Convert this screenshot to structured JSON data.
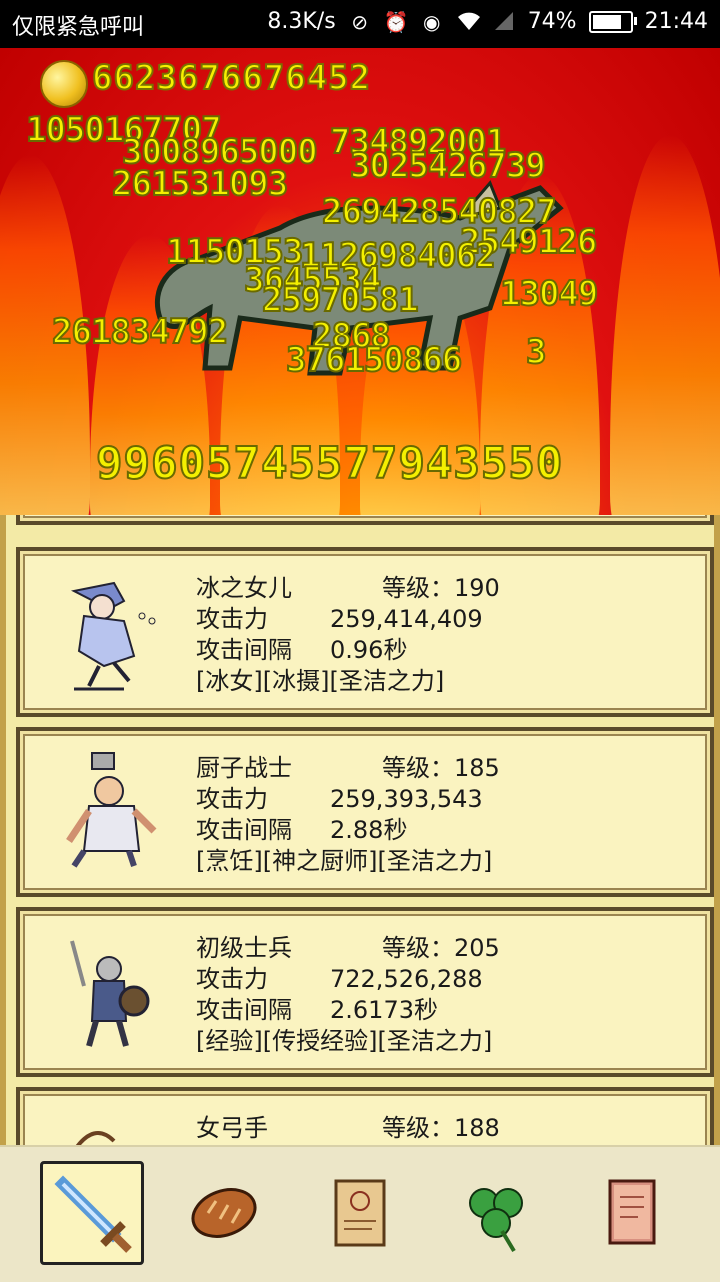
{
  "status_bar": {
    "carrier_text": "仅限紧急呼叫",
    "net_speed": "8.3K/s",
    "battery_percent": "74%",
    "time": "21:44"
  },
  "battle": {
    "gold_amount": "6623676676452",
    "damage_numbers": [
      "1050167707",
      "3008965000",
      "734892001",
      "3025426739",
      "261531093",
      "269428540827",
      "2549126",
      "1150153",
      "1126984062",
      "3645534",
      "25970581",
      "13049",
      "261834792",
      "2868",
      "376150866",
      "3"
    ],
    "total_damage": "99605745577943550"
  },
  "heroes": [
    {
      "name": "冰之女儿",
      "level_label": "等级：190",
      "atk_label": "攻击力",
      "atk_value": "259,414,409",
      "interval_label": "攻击间隔",
      "interval_value": "0.96秒",
      "skills": "[冰女][冰摄][圣洁之力]"
    },
    {
      "name": "厨子战士",
      "level_label": "等级：185",
      "atk_label": "攻击力",
      "atk_value": "259,393,543",
      "interval_label": "攻击间隔",
      "interval_value": "2.88秒",
      "skills": "[烹饪][神之厨师][圣洁之力]"
    },
    {
      "name": "初级士兵",
      "level_label": "等级：205",
      "atk_label": "攻击力",
      "atk_value": "722,526,288",
      "interval_label": "攻击间隔",
      "interval_value": "2.6173秒",
      "skills": "[经验][传授经验][圣洁之力]"
    },
    {
      "name": "女弓手",
      "level_label": "等级：188"
    }
  ],
  "nav": {
    "items": [
      "sword-icon",
      "bread-icon",
      "scroll-icon",
      "clover-icon",
      "book-icon"
    ],
    "active": "sword-icon"
  },
  "colors": {
    "damage_text": "#f4f000",
    "panel_bg": "#f3eaa6",
    "card_border": "#5a4a2a"
  }
}
